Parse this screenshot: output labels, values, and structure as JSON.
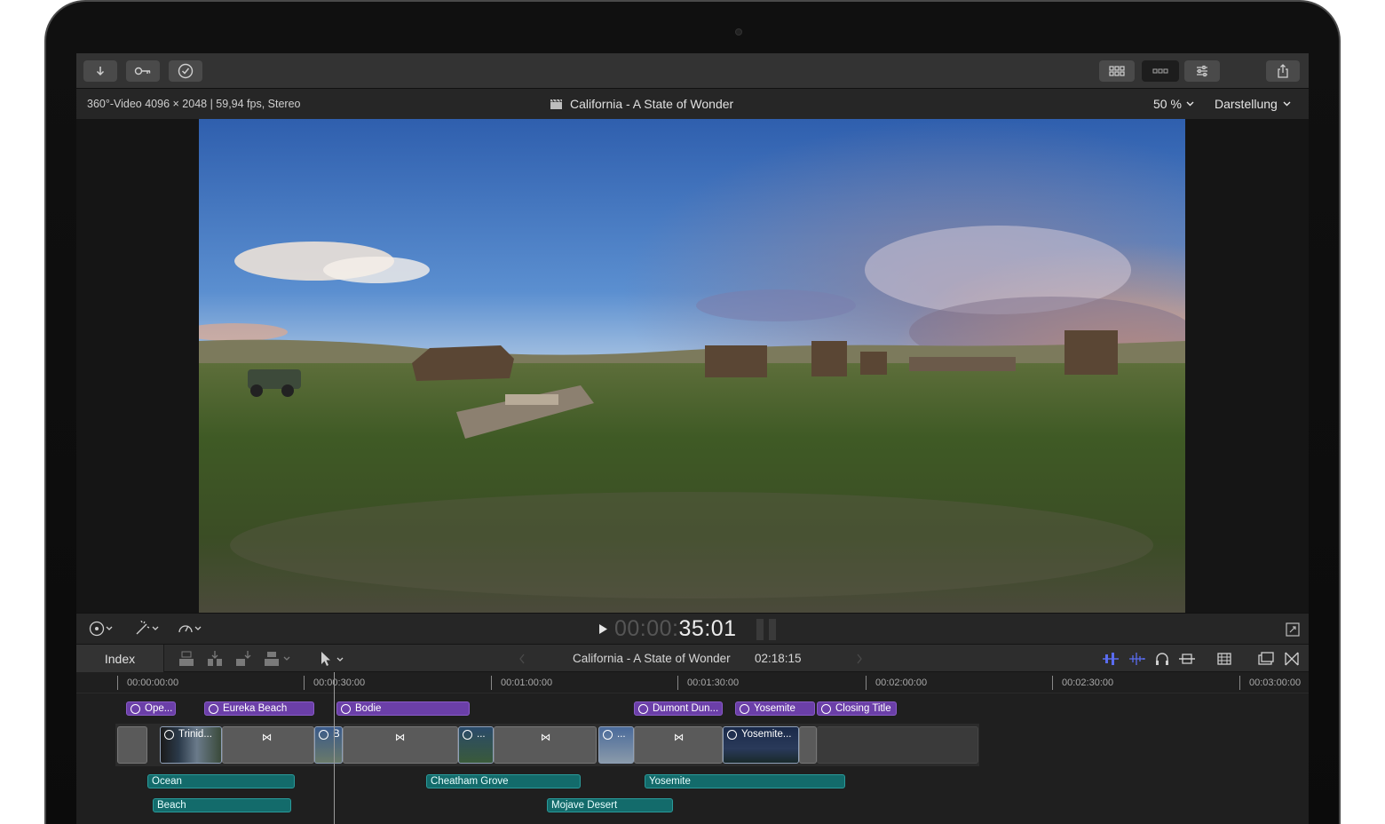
{
  "viewer": {
    "format_info": "360°-Video 4096 × 2048 | 59,94 fps, Stereo",
    "project_title": "California - A State of Wonder",
    "zoom": "50 %",
    "view_menu": "Darstellung"
  },
  "transport": {
    "timecode_dim": "00:00:",
    "timecode": "35:01"
  },
  "timeline_bar": {
    "index_label": "Index",
    "project_title": "California - A State of Wonder",
    "duration": "02:18:15"
  },
  "ruler": {
    "ticks": [
      "00:00:00:00",
      "00:00:30:00",
      "00:01:00:00",
      "00:01:30:00",
      "00:02:00:00",
      "00:02:30:00",
      "00:03:00:00"
    ]
  },
  "title_clips": [
    "Ope...",
    "Eureka Beach",
    "Bodie",
    "Dumont Dun...",
    "Yosemite",
    "Closing Title"
  ],
  "video_clips": [
    "Trinid...",
    "B",
    "...",
    "...",
    "Yosemite..."
  ],
  "audio_clips": [
    "Ocean",
    "Beach",
    "Cheatham Grove",
    "Mojave Desert",
    "Yosemite"
  ],
  "colors": {
    "title_clip": "#6b3fa8",
    "audio_clip": "#136b6b",
    "accent_blue": "#5a6cf0"
  }
}
